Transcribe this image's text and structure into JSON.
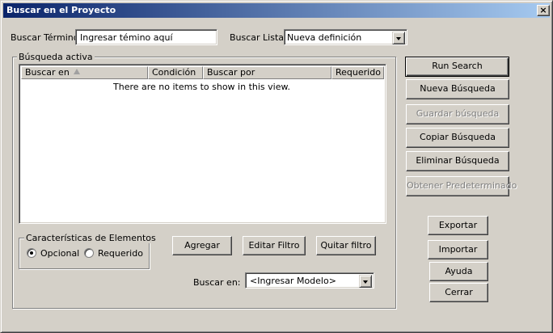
{
  "window": {
    "title": "Buscar en el Proyecto",
    "close_glyph": "×"
  },
  "search": {
    "term_label": "Buscar Término:",
    "term_value": "Ingresar témino aquí",
    "list_label": "Buscar Lista:",
    "list_value": "Nueva definición"
  },
  "active_search": {
    "group_title": "Búsqueda activa",
    "columns": [
      "Buscar en",
      "Condición",
      "Buscar por",
      "Requerido"
    ],
    "empty_message": "There are no items to show in this view."
  },
  "element_features": {
    "group_title": "Características de Elementos",
    "options": [
      {
        "label": "Opcional",
        "checked": true
      },
      {
        "label": "Requerido",
        "checked": false
      }
    ]
  },
  "filter_buttons": {
    "add": "Agregar",
    "edit": "Editar Filtro",
    "remove": "Quitar filtro"
  },
  "search_in": {
    "label": "Buscar en:",
    "value": "<Ingresar Modelo>"
  },
  "side_buttons": {
    "run": "Run Search",
    "new": "Nueva Búsqueda",
    "save": "Guardar búsqueda",
    "copy": "Copiar  Búsqueda",
    "delete": "Eliminar Búsqueda",
    "defaults": "Obtener Predeterminado",
    "export": "Exportar",
    "import": "Importar",
    "help": "Ayuda",
    "close": "Cerrar"
  },
  "colors": {
    "titlebar_start": "#0a246a",
    "titlebar_end": "#a6caf0",
    "face": "#d4d0c8"
  }
}
